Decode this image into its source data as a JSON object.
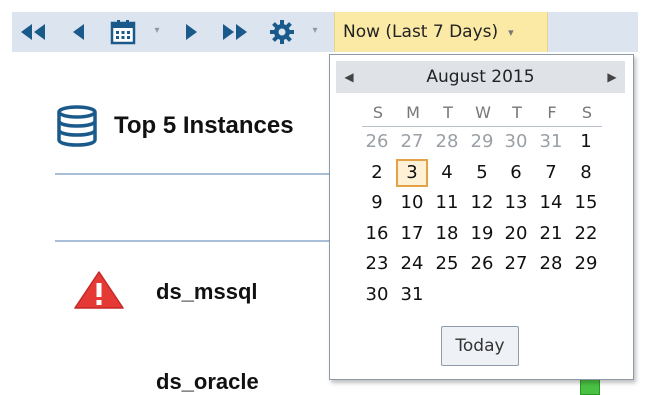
{
  "toolbar": {
    "buttons": [
      {
        "name": "first-page-button",
        "icon": "double-left-arrow-icon"
      },
      {
        "name": "prev-button",
        "icon": "left-arrow-icon"
      },
      {
        "name": "calendar-button",
        "icon": "calendar-icon"
      },
      {
        "name": "next-button",
        "icon": "right-arrow-icon"
      },
      {
        "name": "last-page-button",
        "icon": "double-right-arrow-icon"
      },
      {
        "name": "settings-button",
        "icon": "gear-icon"
      }
    ],
    "range_label": "Now (Last 7 Days)"
  },
  "section": {
    "title": "Top 5 Instances",
    "icon": "database-icon"
  },
  "instances": [
    {
      "name": "ds_mssql",
      "status": "critical"
    },
    {
      "name": "ds_oracle",
      "status": "ok"
    }
  ],
  "calendar": {
    "month_label": "August 2015",
    "weekdays": [
      "S",
      "M",
      "T",
      "W",
      "T",
      "F",
      "S"
    ],
    "weeks": [
      [
        {
          "d": "26",
          "o": true
        },
        {
          "d": "27",
          "o": true
        },
        {
          "d": "28",
          "o": true
        },
        {
          "d": "29",
          "o": true
        },
        {
          "d": "30",
          "o": true
        },
        {
          "d": "31",
          "o": true
        },
        {
          "d": "1"
        }
      ],
      [
        {
          "d": "2"
        },
        {
          "d": "3",
          "sel": true
        },
        {
          "d": "4"
        },
        {
          "d": "5"
        },
        {
          "d": "6"
        },
        {
          "d": "7"
        },
        {
          "d": "8"
        }
      ],
      [
        {
          "d": "9"
        },
        {
          "d": "10"
        },
        {
          "d": "11"
        },
        {
          "d": "12"
        },
        {
          "d": "13"
        },
        {
          "d": "14"
        },
        {
          "d": "15"
        }
      ],
      [
        {
          "d": "16"
        },
        {
          "d": "17"
        },
        {
          "d": "18"
        },
        {
          "d": "19"
        },
        {
          "d": "20"
        },
        {
          "d": "21"
        },
        {
          "d": "22"
        }
      ],
      [
        {
          "d": "23"
        },
        {
          "d": "24"
        },
        {
          "d": "25"
        },
        {
          "d": "26"
        },
        {
          "d": "27"
        },
        {
          "d": "28"
        },
        {
          "d": "29"
        }
      ],
      [
        {
          "d": "30"
        },
        {
          "d": "31"
        }
      ]
    ],
    "today_label": "Today"
  },
  "colors": {
    "accent": "#1a5a8a",
    "selected_outline": "#e3a245",
    "range_bg": "#fbe9a6",
    "critical": "#e53935",
    "ok": "#49c244"
  }
}
